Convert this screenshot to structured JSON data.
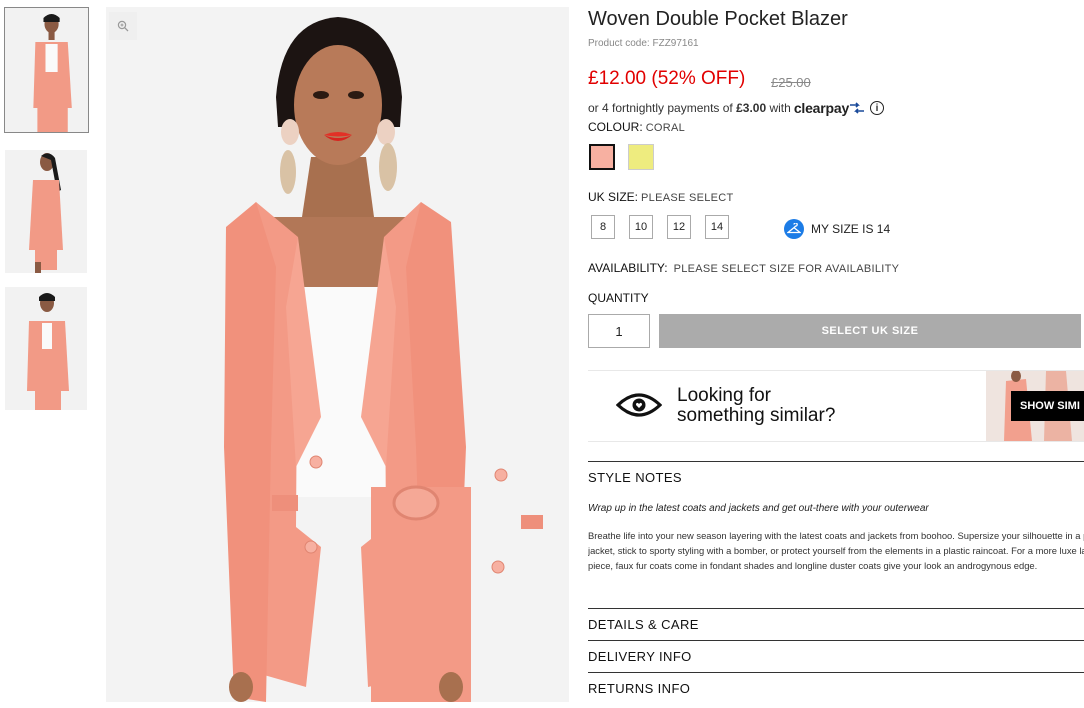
{
  "product": {
    "title": "Woven Double Pocket Blazer",
    "product_code": "Product code: FZZ97161",
    "price": "£12.00 (52% OFF)",
    "was_price": "£25.00"
  },
  "clearpay": {
    "prefix": "or 4 fortnightly payments of",
    "amount": "£3.00",
    "with": "with",
    "logo": "clearpay",
    "info_icon": "i"
  },
  "colour": {
    "label": "COLOUR:",
    "selected": "CORAL",
    "swatches": [
      {
        "name": "coral",
        "color": "#f7b0a1"
      },
      {
        "name": "yellow",
        "color": "#eeec7f"
      }
    ]
  },
  "size": {
    "label": "UK SIZE:",
    "prompt": "PLEASE SELECT",
    "options": [
      "8",
      "10",
      "12",
      "14"
    ],
    "my_size": "MY SIZE IS 14"
  },
  "availability": {
    "label": "AVAILABILITY:",
    "value": "PLEASE SELECT SIZE FOR AVAILABILITY"
  },
  "quantity": {
    "label": "QUANTITY",
    "value": "1"
  },
  "add_button": "SELECT UK SIZE",
  "similar": {
    "line1": "Looking for",
    "line2": "something similar?",
    "button": "SHOW SIMI"
  },
  "style_notes": {
    "heading": "STYLE NOTES",
    "tagline": "Wrap up in the latest coats and jackets and get out-there with your outerwear",
    "body": "Breathe life into your new season layering with the latest coats and jackets from boohoo. Supersize your silhouette in a padded jacket, stick to sporty styling with a bomber, or protect yourself from the elements in a plastic raincoat. For a more luxe layering piece, faux fur coats come in fondant shades and longline duster coats give your look an androgynous edge."
  },
  "sections": [
    "DETAILS & CARE",
    "DELIVERY INFO",
    "RETURNS INFO"
  ],
  "colors": {
    "price_red": "#e10000",
    "coral": "#f7a08a",
    "button_grey": "#ababab",
    "accent_blue": "#1c7ce6"
  }
}
